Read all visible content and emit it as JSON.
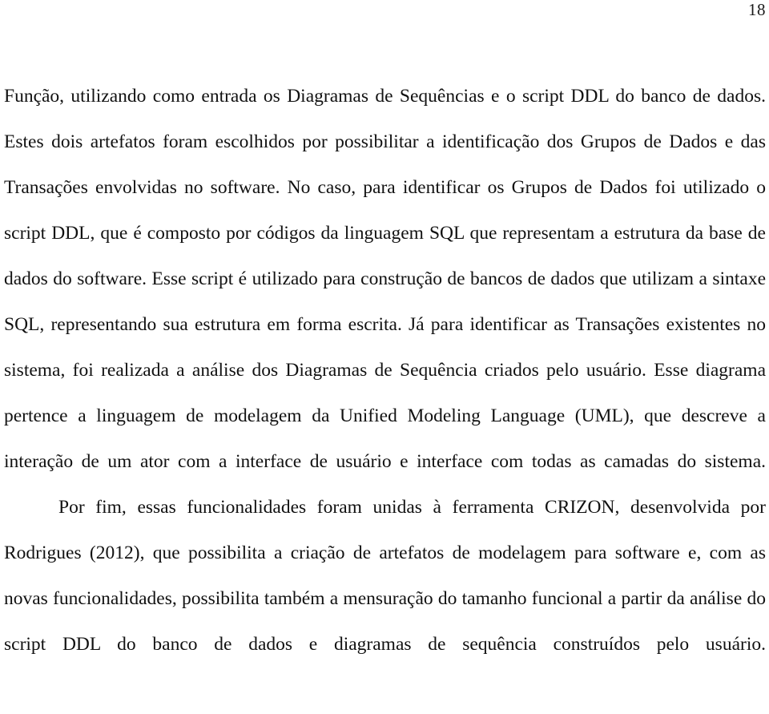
{
  "document": {
    "page_number": "18",
    "language": "pt-BR",
    "paragraphs": [
      {
        "id": "paragraph-1",
        "indented": false,
        "text": "Função, utilizando como entrada os Diagramas de Sequências e o script DDL do banco de dados. Estes dois artefatos foram escolhidos por possibilitar a identificação dos Grupos de Dados e das Transações envolvidas no software. No caso, para identificar os Grupos de Dados foi utilizado o script DDL, que é composto por códigos da linguagem SQL que representam a estrutura da base de dados do software. Esse script é utilizado para construção de bancos de dados que utilizam a sintaxe SQL, representando sua estrutura em forma escrita. Já para identificar as Transações existentes no sistema, foi realizada a análise dos Diagramas de Sequência criados pelo usuário. Esse diagrama pertence a linguagem de modelagem da Unified Modeling Language (UML), que descreve a interação de um ator com a interface de usuário e interface com todas as camadas do sistema."
      },
      {
        "id": "paragraph-2",
        "indented": true,
        "text": "Por fim, essas funcionalidades foram unidas à ferramenta CRIZON, desenvolvida por Rodrigues (2012), que possibilita a criação de artefatos de modelagem para software e, com as novas funcionalidades, possibilita também a mensuração do tamanho funcional a partir da análise do script DDL do banco de dados e diagramas de sequência construídos pelo usuário."
      }
    ],
    "lines": [
      "Função, utilizando como entrada os Diagramas de Sequências e o script DDL do banco de",
      "dados. Estes dois artefatos foram escolhidos por possibilitar a identificação dos Grupos de",
      "Dados e das Transações envolvidas no software. No caso, para identificar os Grupos de Dados",
      "foi utilizado o script DDL, que é composto por códigos da linguagem SQL que representam a",
      "estrutura da base de dados do software. Esse script é utilizado para construção de bancos de",
      "dados que utilizam a sintaxe SQL, representando sua estrutura em forma escrita. Já para",
      "identificar as Transações existentes no sistema, foi realizada a análise dos Diagramas de",
      "Sequência criados pelo usuário. Esse diagrama pertence a linguagem de modelagem da Unified",
      "Modeling Language (UML), que descreve a interação de um ator com a interface de usuário e",
      "interface com todas as camadas do sistema.",
      "Por fim, essas funcionalidades foram unidas à ferramenta CRIZON, desenvolvida por",
      "Rodrigues (2012), que possibilita a criação de artefatos de modelagem para software e, com as",
      "novas funcionalidades, possibilita também a mensuração do tamanho funcional a partir da",
      "análise do script DDL do banco de dados e diagramas de sequência construídos pelo usuário."
    ],
    "colors": {
      "background": "#ffffff",
      "text": "#111111",
      "page_number": "#1a1a1a"
    }
  }
}
